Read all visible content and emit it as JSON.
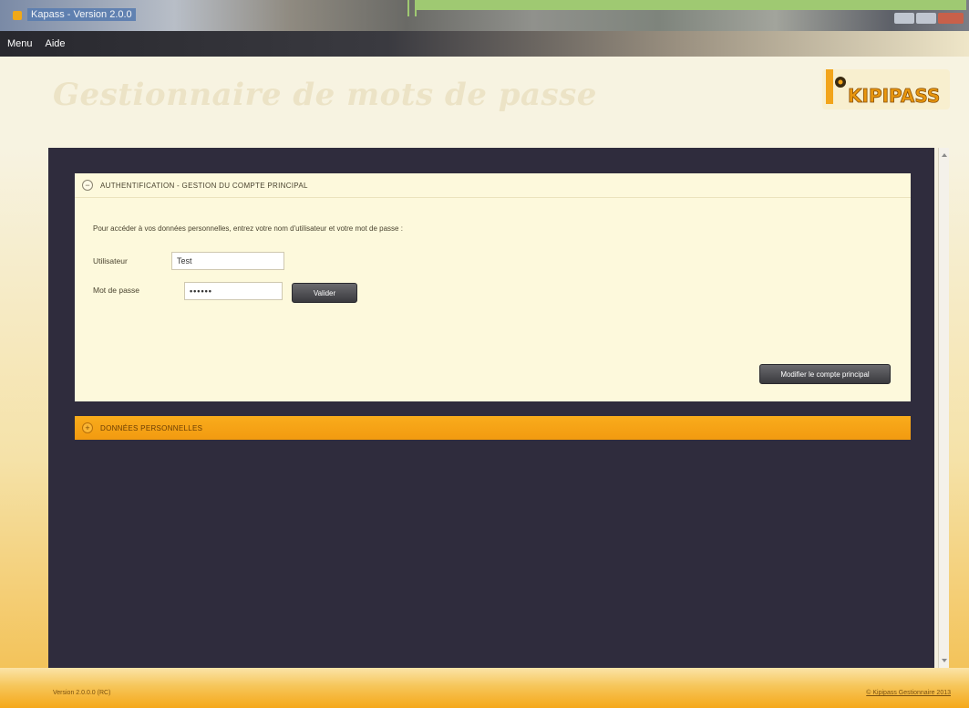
{
  "window": {
    "title": "Kapass - Version 2.0.0"
  },
  "menubar": {
    "items": [
      {
        "label": "Menu"
      },
      {
        "label": "Aide"
      }
    ]
  },
  "header": {
    "title": "Gestionnaire de mots de passe",
    "logo_text": "KIPIPASS"
  },
  "auth": {
    "section_title": "AUTHENTIFICATION - GESTION DU COMPTE PRINCIPAL",
    "toggle_symbol": "−",
    "intro": "Pour accéder à vos données personnelles, entrez votre nom d'utilisateur et votre mot de passe :",
    "user_label": "Utilisateur",
    "user_value": "Test",
    "password_label": "Mot de passe",
    "password_value": "••••••",
    "validate_label": "Valider",
    "modify_label": "Modifier le compte principal"
  },
  "perso": {
    "section_title": "DONNÉES PERSONNELLES",
    "toggle_symbol": "+"
  },
  "footer": {
    "version": "Version 2.0.0.0 (RC)",
    "copyright": "© Kipipass Gestionnaire 2013"
  },
  "colors": {
    "panel_dark": "#2f2c3d",
    "auth_bg": "#fdf9dc",
    "accent_orange": "#f5a81a"
  }
}
